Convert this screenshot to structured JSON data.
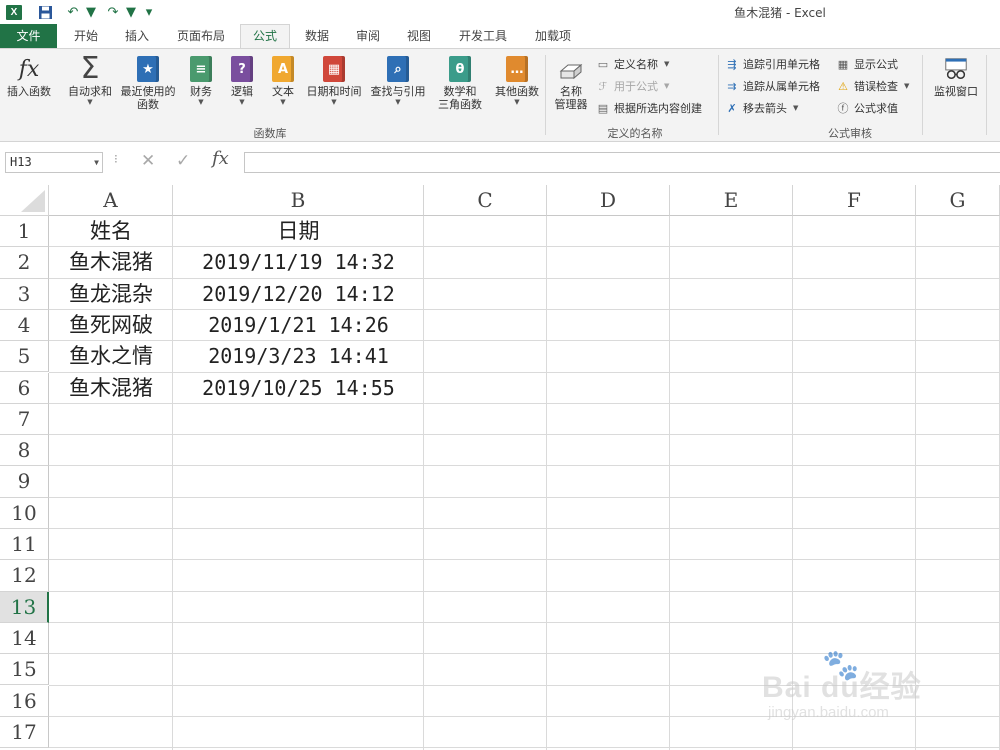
{
  "window": {
    "title": "鱼木混猪 - Excel"
  },
  "quick_access": {
    "app_icon": "excel-icon",
    "app_letter": "X",
    "save_icon": "save-icon",
    "undo_icon": "undo-icon",
    "redo_icon": "redo-icon",
    "customize_icon": "customize-icon"
  },
  "tabs": {
    "file": "文件",
    "items": [
      "开始",
      "插入",
      "页面布局",
      "公式",
      "数据",
      "审阅",
      "视图",
      "开发工具",
      "加载项"
    ],
    "active": "公式"
  },
  "ribbon": {
    "function_library": {
      "label": "函数库",
      "insert_function": "插入函数",
      "autosum": "自动求和",
      "recent_line1": "最近使用的",
      "recent_line2": "函数",
      "financial": "财务",
      "logical": "逻辑",
      "text": "文本",
      "datetime": "日期和时间",
      "lookup": "查找与引用",
      "math_line1": "数学和",
      "math_line2": "三角函数",
      "more": "其他函数"
    },
    "defined_names": {
      "label": "定义的名称",
      "name_manager_line1": "名称",
      "name_manager_line2": "管理器",
      "define_name": "定义名称",
      "use_in_formula": "用于公式",
      "create_from_selection": "根据所选内容创建"
    },
    "formula_auditing": {
      "label": "公式审核",
      "trace_precedents": "追踪引用单元格",
      "trace_dependents": "追踪从属单元格",
      "remove_arrows": "移去箭头",
      "show_formulas": "显示公式",
      "error_checking": "错误检查",
      "evaluate_formula": "公式求值",
      "watch_window": "监视窗口"
    },
    "colors": {
      "accent": "#217346",
      "financial": "#4a9a6e",
      "logical": "#7a4e9e",
      "text": "#f0a830",
      "datetime": "#d0473a",
      "lookup": "#2e6fb5",
      "math": "#3b9c8a",
      "more": "#e08a2e"
    }
  },
  "formula_bar": {
    "name_box": "H13",
    "fx_label": "fx",
    "formula": ""
  },
  "sheet": {
    "columns": [
      "A",
      "B",
      "C",
      "D",
      "E",
      "F",
      "G"
    ],
    "rows": [
      "1",
      "2",
      "3",
      "4",
      "5",
      "6",
      "7",
      "8",
      "9",
      "10",
      "11",
      "12",
      "13",
      "14",
      "15",
      "16",
      "17"
    ],
    "active_row": "13",
    "data": [
      [
        "姓名",
        "日期"
      ],
      [
        "鱼木混猪",
        "2019/11/19 14:32"
      ],
      [
        "鱼龙混杂",
        "2019/12/20 14:12"
      ],
      [
        "鱼死网破",
        "2019/1/21 14:26"
      ],
      [
        "鱼水之情",
        "2019/3/23 14:41"
      ],
      [
        "鱼木混猪",
        "2019/10/25 14:55"
      ]
    ]
  },
  "watermark": {
    "brand": "Bai  du经验",
    "url": "jingyan.baidu.com"
  }
}
